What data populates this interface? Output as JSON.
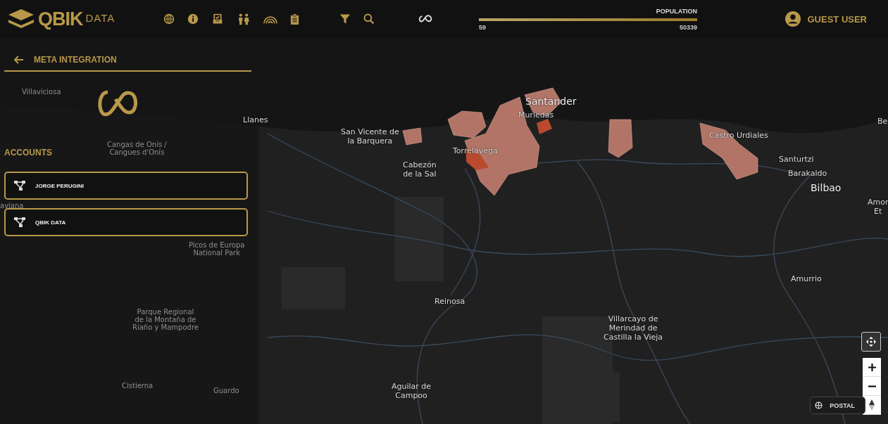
{
  "logo": {
    "brand": "QBIK",
    "suffix": "DATA"
  },
  "population": {
    "label": "POPULATION",
    "min": "59",
    "max": "50339",
    "level": 1
  },
  "user": {
    "name": "GUEST USER"
  },
  "panel": {
    "title": "META INTEGRATION",
    "section": "ACCOUNTS",
    "accounts": [
      {
        "name": "JORGE PERUGINI"
      },
      {
        "name": "QBIK DATA"
      }
    ]
  },
  "map": {
    "labels": [
      {
        "text": "Villaviciosa",
        "kind": "faded"
      },
      {
        "text": "Cangas de Onís /\nCangues d'Onís",
        "kind": "faded"
      },
      {
        "text": "aviana",
        "kind": "faded"
      },
      {
        "text": "Picos de Europa\nNational Park",
        "kind": "faded"
      },
      {
        "text": "Parque Regional\nde la Montaña de\nRiaño y Mampodre",
        "kind": "faded"
      },
      {
        "text": "Cistierna",
        "kind": "faded"
      },
      {
        "text": "Guardo",
        "kind": "faded"
      },
      {
        "text": "Llanes",
        "kind": "town"
      },
      {
        "text": "San Vicente de\nla Barquera",
        "kind": "town"
      },
      {
        "text": "Santander",
        "kind": "city"
      },
      {
        "text": "Muriedas",
        "kind": "town"
      },
      {
        "text": "Torrelavega",
        "kind": "town"
      },
      {
        "text": "Cabezón\nde la Sal",
        "kind": "town"
      },
      {
        "text": "Castro Urdiales",
        "kind": "town"
      },
      {
        "text": "Santurtzi",
        "kind": "town"
      },
      {
        "text": "Barakaldo",
        "kind": "town"
      },
      {
        "text": "Bilbao",
        "kind": "city"
      },
      {
        "text": "Amor\nEt",
        "kind": "town"
      },
      {
        "text": "Be",
        "kind": "town"
      },
      {
        "text": "Amurrio",
        "kind": "town"
      },
      {
        "text": "Reinosa",
        "kind": "town"
      },
      {
        "text": "Villarcayo de\nMerindad de\nCastilla la Vieja",
        "kind": "town"
      },
      {
        "text": "Aguilar de\nCampoo",
        "kind": "town"
      }
    ],
    "layer": "POSTAL"
  }
}
